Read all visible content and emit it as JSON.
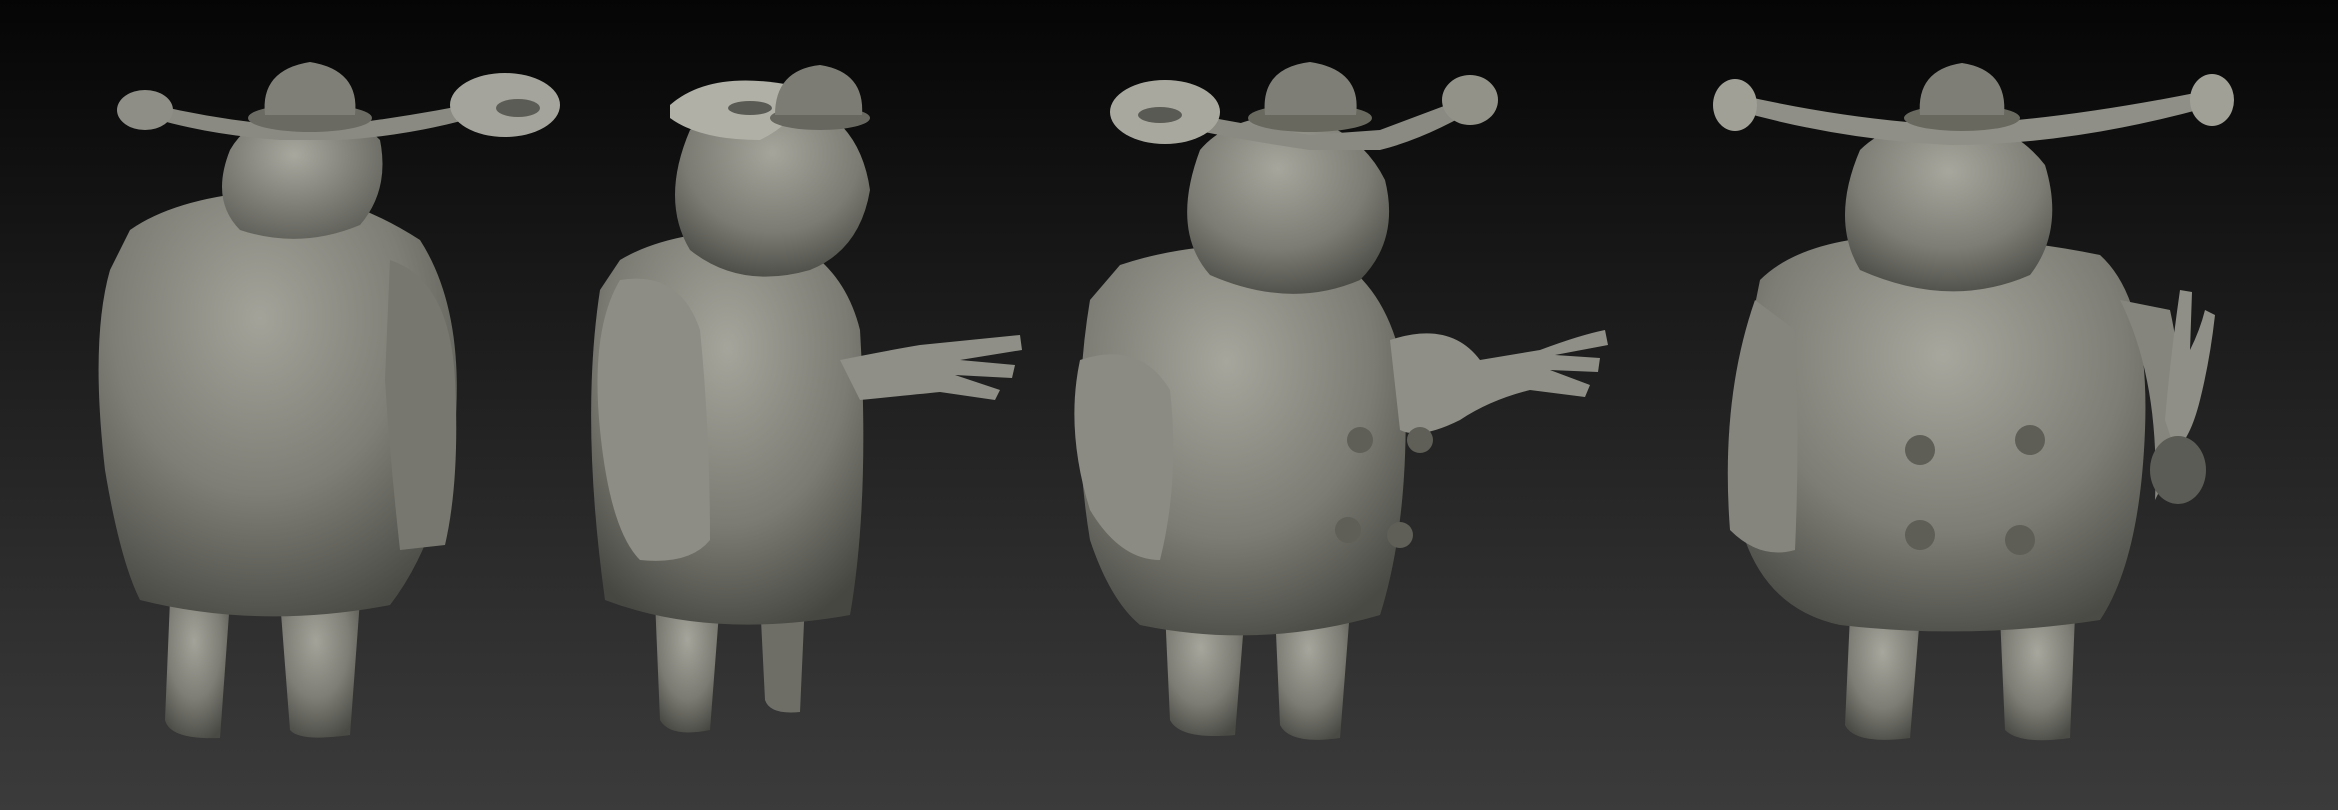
{
  "scene": {
    "description_tag": "sculpt-turnaround",
    "views": [
      {
        "id": "back",
        "label": ""
      },
      {
        "id": "side",
        "label": ""
      },
      {
        "id": "three-quarter",
        "label": ""
      },
      {
        "id": "front",
        "label": ""
      }
    ]
  },
  "colors": {
    "background_top": "#050505",
    "background_bottom": "#3b3b3b",
    "clay_light": "#9a9a90",
    "clay_mid": "#7d7d75",
    "clay_dark": "#55554f",
    "clay_shadow": "#3e3e3a"
  }
}
